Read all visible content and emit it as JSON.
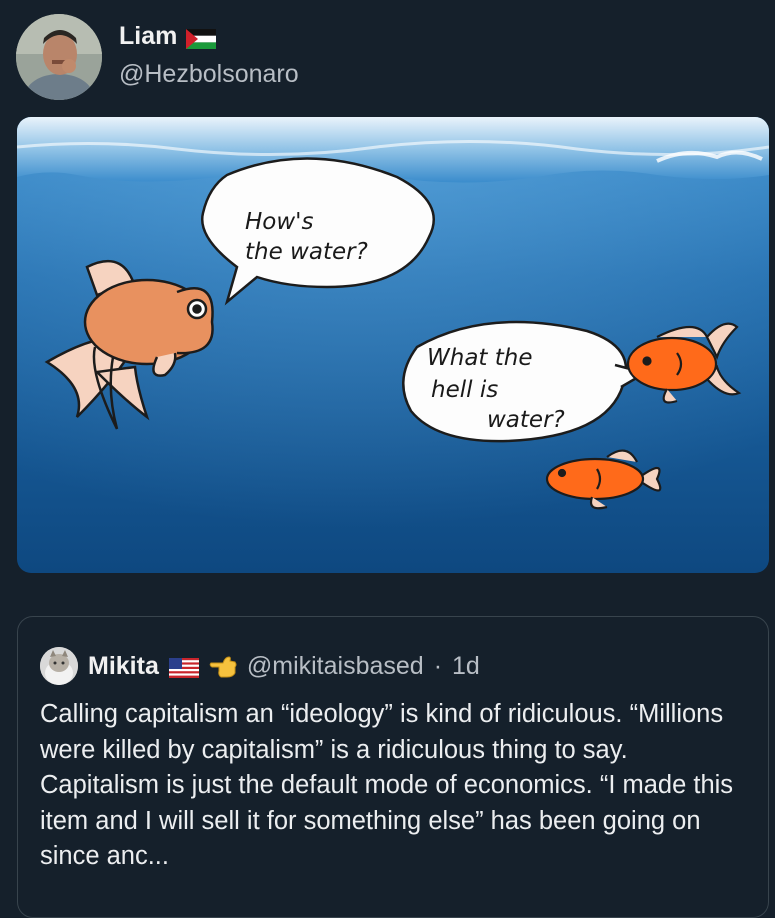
{
  "tweet": {
    "author": {
      "name": "Liam",
      "handle": "@Hezbolsonaro",
      "flag_icon": "palestine-flag-icon"
    },
    "media": {
      "speech_bubble_1": [
        "How's",
        "the water?"
      ],
      "speech_bubble_2": [
        "What the",
        "hell is",
        "water?"
      ],
      "colors": {
        "water_top": "#2f7fc0",
        "water_bottom": "#0f4a86",
        "large_fish": "#e8915f",
        "small_fish": "#ff6a1a"
      }
    }
  },
  "quoted_tweet": {
    "author": {
      "name": "Mikita",
      "handle": "@mikitaisbased",
      "time": "1d",
      "separator": "·",
      "flag_icon": "usa-flag-icon",
      "badge_icon": "pointing-hand-icon"
    },
    "body": "Calling capitalism an “ideology” is kind of ridiculous. “Millions were killed by capitalism” is a ridiculous thing to say. Capitalism is just the default mode of economics. “I made this item and I will sell it for something else” has been going on since anc..."
  },
  "theme": {
    "background": "#15202b",
    "border": "#38444d",
    "secondary_text": "#b8bec5"
  }
}
